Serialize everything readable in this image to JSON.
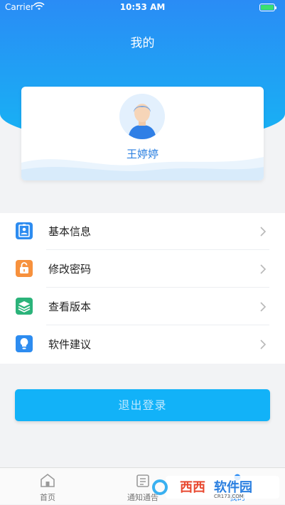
{
  "status_bar": {
    "carrier": "Carrier",
    "time": "10:53 AM"
  },
  "header": {
    "title": "我的"
  },
  "profile": {
    "name": "王婷婷"
  },
  "menu": {
    "items": [
      {
        "label": "基本信息",
        "icon": "id-card-icon",
        "color": "#2d8cf0"
      },
      {
        "label": "修改密码",
        "icon": "lock-icon",
        "color": "#f7913d"
      },
      {
        "label": "查看版本",
        "icon": "layers-icon",
        "color": "#2bb37a"
      },
      {
        "label": "软件建议",
        "icon": "lightbulb-icon",
        "color": "#2d8cf0"
      }
    ]
  },
  "logout": {
    "label": "退出登录"
  },
  "tabs": [
    {
      "label": "首页",
      "icon": "home-icon",
      "active": false
    },
    {
      "label": "通知通告",
      "icon": "notice-icon",
      "active": false
    },
    {
      "label": "我的",
      "icon": "user-icon",
      "active": true
    }
  ],
  "watermark": {
    "text": "西西软件园",
    "sub": "CR173.COM"
  },
  "colors": {
    "primary": "#2a8cf5",
    "button": "#12b2f8"
  }
}
